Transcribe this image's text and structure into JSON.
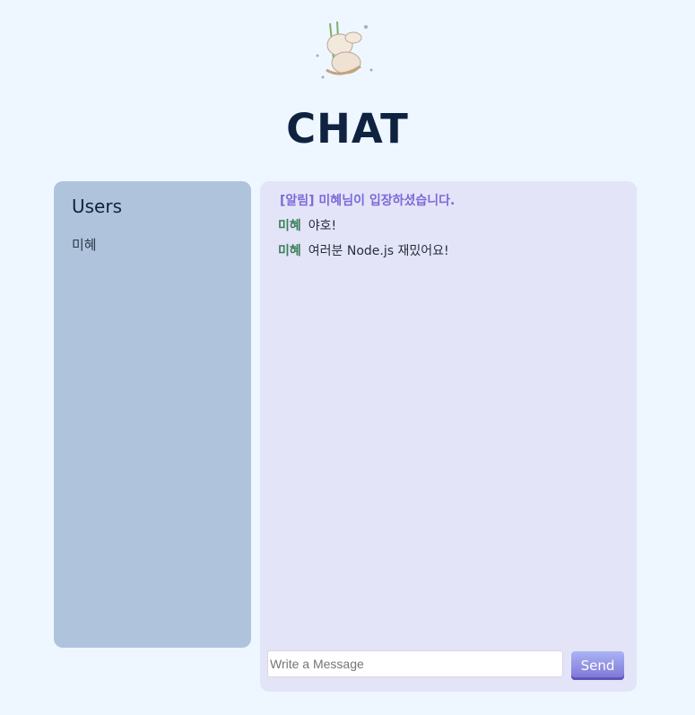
{
  "header": {
    "logo": "bunny-swing-illustration",
    "title": "CHAT"
  },
  "users": {
    "heading": "Users",
    "items": [
      "미혜"
    ]
  },
  "chat": {
    "notice": "[알림] 미혜님이 입장하셨습니다.",
    "messages": [
      {
        "sender": "미혜",
        "text": "야호!"
      },
      {
        "sender": "미혜",
        "text": "여러분 Node.js 재밌어요!"
      }
    ],
    "input": {
      "value": "",
      "placeholder": "Write a Message"
    },
    "send_label": "Send"
  },
  "colors": {
    "background": "#eef7ff",
    "users_panel": "#afc4dc",
    "chat_panel": "#e4e4f8",
    "notice": "#7b6ad8",
    "sender": "#3a7f5a",
    "title": "#0f2340"
  }
}
